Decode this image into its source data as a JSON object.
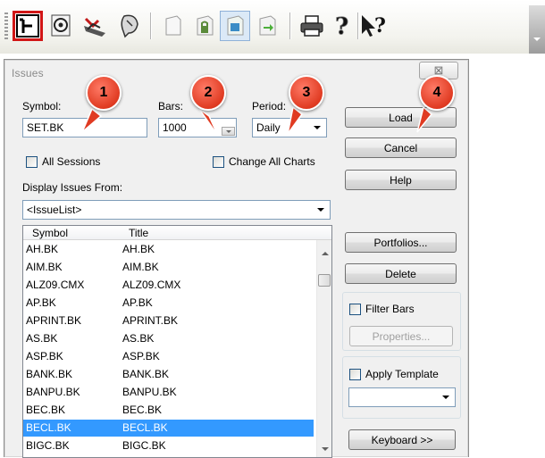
{
  "toolbar": {
    "icons": [
      "open-chart-icon",
      "search-globe-icon",
      "indicator-icon",
      "mouse-head-icon",
      "new-page-icon",
      "lock-page-icon",
      "active-window-icon",
      "arrow-window-icon",
      "printer-icon",
      "help-icon",
      "context-help-icon"
    ],
    "highlight_color": "#d11616"
  },
  "dialog": {
    "title": "Issues",
    "close_glyph": "⊠",
    "symbol_label": "Symbol:",
    "symbol_value": "SET.BK",
    "bars_label": "Bars:",
    "bars_value": "1000",
    "period_label": "Period:",
    "period_value": "Daily",
    "all_sessions": "All Sessions",
    "change_all_charts": "Change All Charts",
    "display_from_label": "Display Issues From:",
    "display_from_value": "<IssueList>",
    "buttons": {
      "load": "Load",
      "cancel": "Cancel",
      "help": "Help",
      "portfolios": "Portfolios...",
      "delete": "Delete",
      "properties": "Properties...",
      "keyboard": "Keyboard >>"
    },
    "filter_bars": "Filter Bars",
    "apply_template": "Apply Template",
    "template_value": ""
  },
  "list": {
    "columns": [
      "Symbol",
      "Title"
    ],
    "rows": [
      {
        "symbol": "AH.BK",
        "title": "AH.BK"
      },
      {
        "symbol": "AIM.BK",
        "title": "AIM.BK"
      },
      {
        "symbol": "ALZ09.CMX",
        "title": "ALZ09.CMX"
      },
      {
        "symbol": "AP.BK",
        "title": "AP.BK"
      },
      {
        "symbol": "APRINT.BK",
        "title": "APRINT.BK"
      },
      {
        "symbol": "AS.BK",
        "title": "AS.BK"
      },
      {
        "symbol": "ASP.BK",
        "title": "ASP.BK"
      },
      {
        "symbol": "BANK.BK",
        "title": "BANK.BK"
      },
      {
        "symbol": "BANPU.BK",
        "title": "BANPU.BK"
      },
      {
        "symbol": "BEC.BK",
        "title": "BEC.BK"
      },
      {
        "symbol": "BECL.BK",
        "title": "BECL.BK",
        "selected": true
      },
      {
        "symbol": "BIGC.BK",
        "title": "BIGC.BK"
      }
    ],
    "selection_color": "#3399ff"
  },
  "callouts": [
    "1",
    "2",
    "3",
    "4"
  ],
  "callout_color": "#e03b22"
}
